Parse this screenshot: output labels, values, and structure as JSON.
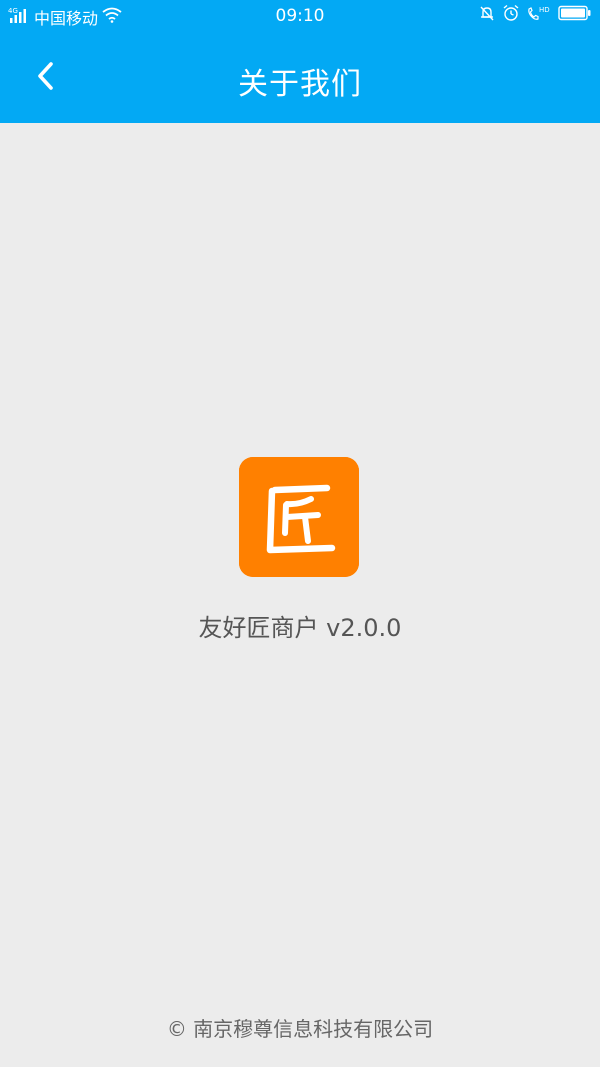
{
  "status_bar": {
    "network_type": "4G",
    "carrier": "中国移动",
    "time": "09:10",
    "icons": [
      "signal-icon",
      "wifi-icon",
      "mute-icon",
      "alarm-icon",
      "hd-call-icon",
      "battery-icon"
    ],
    "hd_label": "HD"
  },
  "nav": {
    "title": "关于我们",
    "back_icon": "chevron-left-icon"
  },
  "about": {
    "logo_char": "匠",
    "app_name": "友好匠商户",
    "version": "v2.0.0",
    "app_name_full": "友好匠商户 v2.0.0",
    "copyright": "© 南京穆尊信息科技有限公司"
  },
  "colors": {
    "primary": "#03a9f4",
    "logo_bg": "#ff8000",
    "background": "#ececec"
  }
}
